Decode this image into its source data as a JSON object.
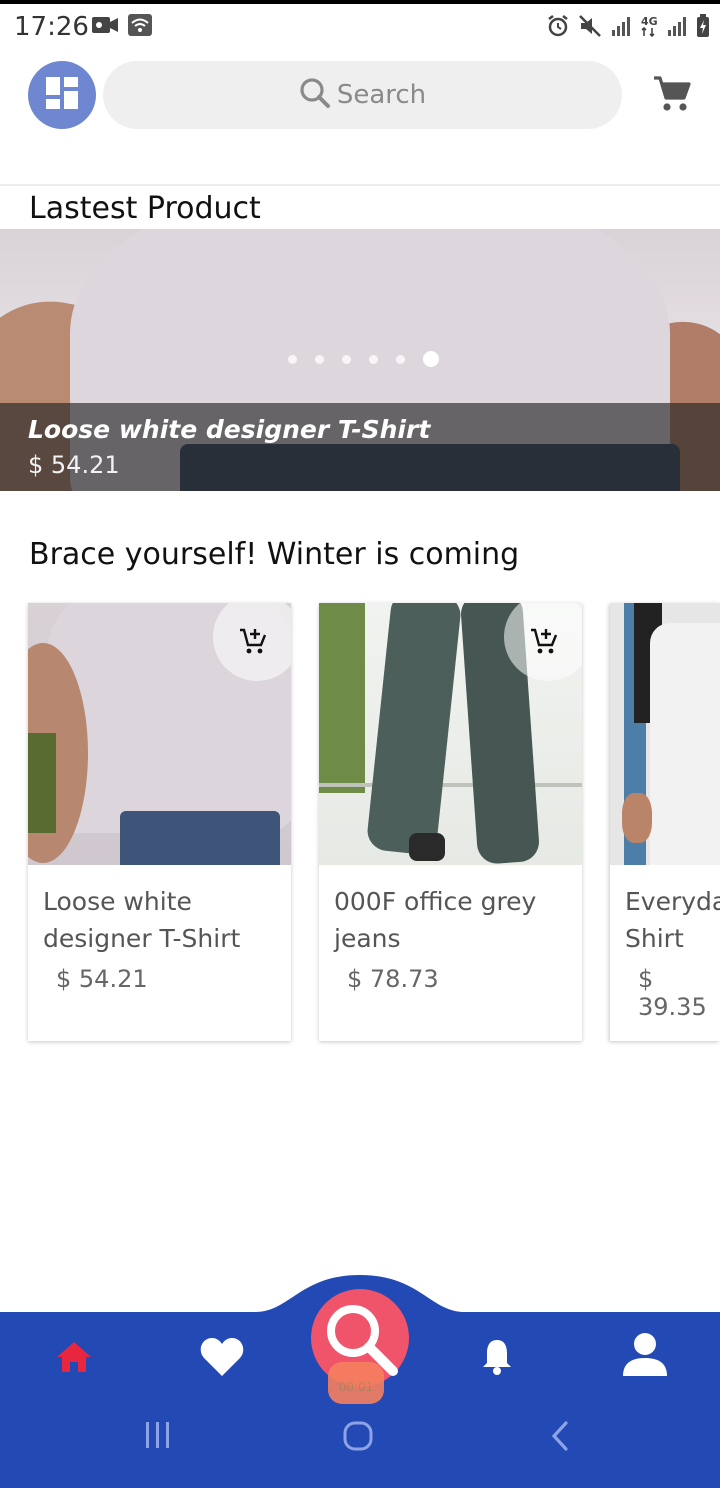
{
  "status_bar": {
    "time": "17:26",
    "icons": [
      "video-camera-icon",
      "wifi-icon",
      "alarm-icon",
      "mute-icon",
      "signal-icon",
      "4g-icon",
      "signal-icon",
      "battery-charging-icon"
    ]
  },
  "header": {
    "menu_icon": "dashboard-icon",
    "search_placeholder": "Search",
    "cart_icon": "cart-icon",
    "accent_color": "#6f86d1"
  },
  "latest": {
    "title": "Lastest Product",
    "slide": {
      "name": "Loose white designer T-Shirt",
      "price": "$ 54.21"
    },
    "slide_count": 6,
    "active_slide": 6
  },
  "winter": {
    "title": "Brace yourself! Winter is coming",
    "products": [
      {
        "name": "Loose white designer T-Shirt",
        "price": "$ 54.21"
      },
      {
        "name": "000F office grey jeans",
        "price": "$ 78.73"
      },
      {
        "name": "Everyday basic T-Shirt",
        "price": "$ 39.35"
      }
    ]
  },
  "bottom_nav": {
    "bar_color": "#2349b4",
    "active_color": "#e8263e",
    "items": [
      "home-icon",
      "heart-icon",
      "search-icon",
      "bell-icon",
      "profile-icon"
    ],
    "recording_label": "00:01"
  },
  "system_nav": [
    "recent-apps-icon",
    "home-circle-icon",
    "back-icon"
  ]
}
